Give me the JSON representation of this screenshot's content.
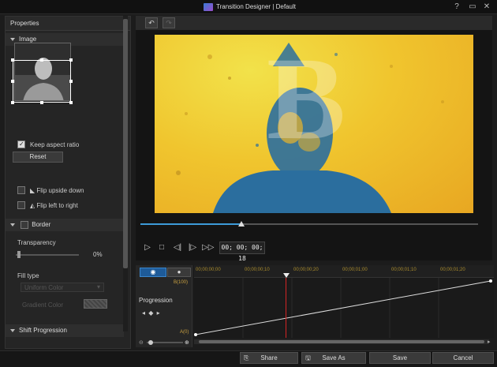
{
  "window": {
    "title": "Transition Designer  |  Default",
    "help": "?",
    "restore": "▭",
    "close": "✕"
  },
  "properties": {
    "header": "Properties",
    "image_section": "Image",
    "keep_aspect_ratio": "Keep aspect ratio",
    "reset": "Reset",
    "flip_upside_down": "Flip upside down",
    "flip_left_to_right": "Flip left to right",
    "border_section": "Border",
    "transparency_label": "Transparency",
    "transparency_value": "0%",
    "fill_type_label": "Fill type",
    "fill_type_value": "Uniform Color",
    "gradient_label": "Gradient Color",
    "shift_progression": "Shift Progression"
  },
  "preview": {
    "letter": "B",
    "timecode": "00; 00; 00; 18",
    "seek_fraction": 0.3
  },
  "timeline": {
    "tab_a": "◉",
    "tab_b": "●",
    "progression_label": "Progression",
    "b_label": "B(100)",
    "a_label": "A(0)",
    "ticks": [
      "00;00;00;00",
      "00;00;00;10",
      "00;00;00;20",
      "00;00;01;00",
      "00;00;01;10",
      "00;00;01;20"
    ]
  },
  "footer": {
    "share": "Share",
    "save_as": "Save As",
    "save": "Save",
    "cancel": "Cancel"
  },
  "colors": {
    "accent": "#3d9bd8",
    "playhead": "#d42424",
    "preview_yellow": "#f0c52e",
    "preview_blue": "#2b6e9e"
  }
}
